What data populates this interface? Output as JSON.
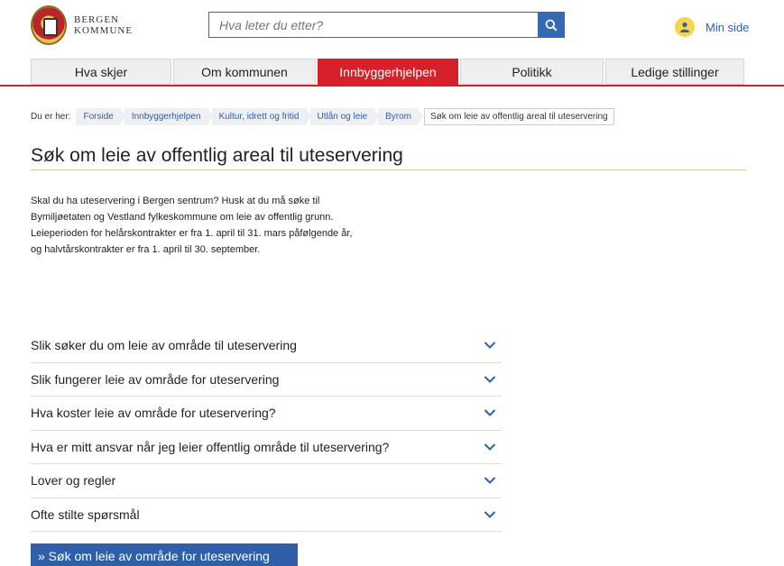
{
  "logo": {
    "line1": "BERGEN",
    "line2": "KOMMUNE"
  },
  "search": {
    "placeholder": "Hva leter du etter?"
  },
  "user": {
    "label": "Min side"
  },
  "nav": {
    "items": [
      {
        "label": "Hva skjer"
      },
      {
        "label": "Om kommunen"
      },
      {
        "label": "Innbyggerhjelpen"
      },
      {
        "label": "Politikk"
      },
      {
        "label": "Ledige stillinger"
      }
    ],
    "active_index": 2
  },
  "breadcrumb": {
    "prefix": "Du er her:",
    "items": [
      "Forside",
      "Innbyggerhjelpen",
      "Kultur, idrett og fritid",
      "Utlån og leie",
      "Byrom"
    ],
    "current": "Søk om leie av offentlig areal til uteservering"
  },
  "page": {
    "title": "Søk om leie av offentlig areal til uteservering",
    "intro_lines": [
      "Skal du ha uteservering i Bergen sentrum? Husk at du må søke til",
      "Bymiljøetaten og Vestland fylkeskommune om leie av offentlig grunn.",
      "Leieperioden for helårskontrakter er fra 1. april til 31. mars påfølgende år,",
      "og halvtårskontrakter er fra 1. april til 30. september."
    ]
  },
  "accordion": [
    "Slik søker du om leie av område til uteservering",
    "Slik fungerer leie av område for uteservering",
    "Hva koster leie av område for uteservering?",
    "Hva er mitt ansvar når jeg leier offentlig område til uteservering?",
    "Lover og regler",
    "Ofte stilte spørsmål"
  ],
  "cta": {
    "label": "» Søk om leie av område for uteservering"
  },
  "colors": {
    "brand_red": "#d8202a",
    "link_blue": "#2e5fa8",
    "search_blue": "#3569b3"
  }
}
